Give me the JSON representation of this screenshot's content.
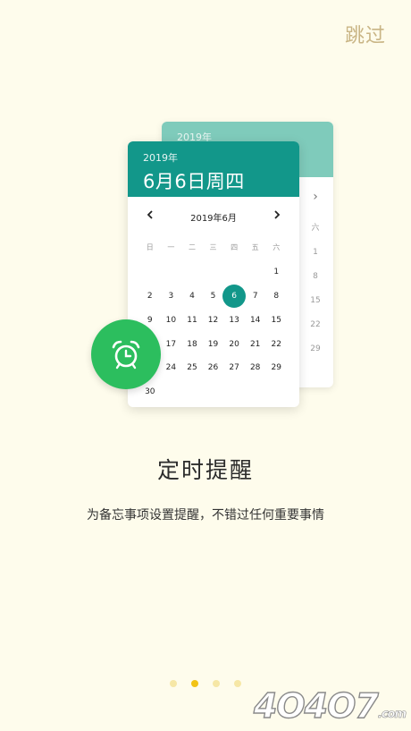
{
  "header": {
    "skip_label": "跳过"
  },
  "back_card": {
    "year": "2019年",
    "partial_column": [
      "六",
      "1",
      "8",
      "15",
      "22",
      "29"
    ]
  },
  "calendar": {
    "year": "2019年",
    "date_title": "6月6日周四",
    "month_label": "2019年6月",
    "prev_icon": "chevron-left-icon",
    "next_icon": "chevron-right-icon",
    "weekdays": [
      "日",
      "一",
      "二",
      "三",
      "四",
      "五",
      "六"
    ],
    "weeks": [
      [
        "",
        "",
        "",
        "",
        "",
        "",
        "1"
      ],
      [
        "2",
        "3",
        "4",
        "5",
        "6",
        "7",
        "8"
      ],
      [
        "9",
        "10",
        "11",
        "12",
        "13",
        "14",
        "15"
      ],
      [
        "16",
        "17",
        "18",
        "19",
        "20",
        "21",
        "22"
      ],
      [
        "23",
        "24",
        "25",
        "26",
        "27",
        "28",
        "29"
      ],
      [
        "30",
        "",
        "",
        "",
        "",
        "",
        ""
      ]
    ],
    "selected_day": "6",
    "accent_color": "#12978A"
  },
  "alarm": {
    "icon": "alarm-clock-icon",
    "color": "#2CBE5E"
  },
  "onboarding": {
    "title": "定时提醒",
    "description": "为备忘事项设置提醒，不错过任何重要事情",
    "page_count": 4,
    "current_page": 2
  },
  "watermark": {
    "main": "4O4O7",
    "suffix": ".com"
  }
}
